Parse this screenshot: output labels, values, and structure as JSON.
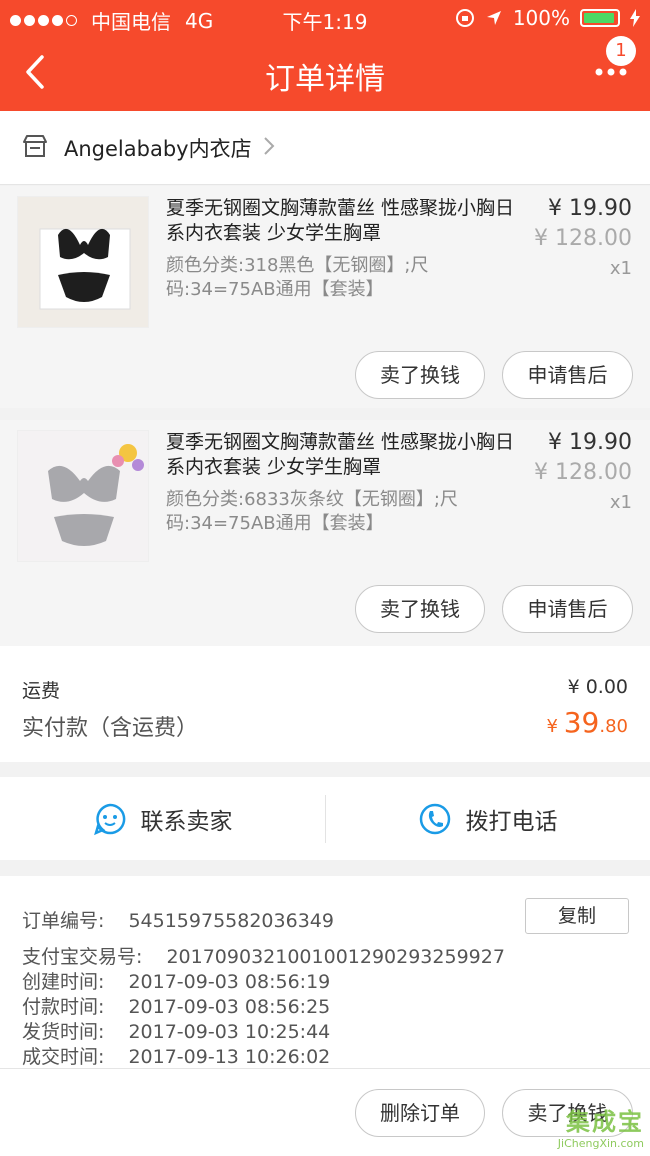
{
  "status_bar": {
    "carrier": "中国电信",
    "network": "4G",
    "time": "下午1:19",
    "battery": "100%"
  },
  "nav": {
    "title": "订单详情",
    "badge": "1"
  },
  "shop": {
    "name": "Angelababy内衣店"
  },
  "products": [
    {
      "title": "夏季无钢圈文胸薄款蕾丝 性感聚拢小胸日系内衣套装 少女学生胸罩",
      "spec": "颜色分类:318黑色【无钢圈】;尺码:34=75AB通用【套装】",
      "price": "¥ 19.90",
      "original_price": "¥ 128.00",
      "qty": "x1",
      "btn_sell": "卖了换钱",
      "btn_after": "申请售后"
    },
    {
      "title": "夏季无钢圈文胸薄款蕾丝 性感聚拢小胸日系内衣套装 少女学生胸罩",
      "spec": "颜色分类:6833灰条纹【无钢圈】;尺码:34=75AB通用【套装】",
      "price": "¥ 19.90",
      "original_price": "¥ 128.00",
      "qty": "x1",
      "btn_sell": "卖了换钱",
      "btn_after": "申请售后"
    }
  ],
  "totals": {
    "shipping_label": "运费",
    "shipping_value": "¥ 0.00",
    "paid_label": "实付款（含运费）",
    "paid_symbol": "¥ ",
    "paid_integer": "39",
    "paid_decimal": ".80"
  },
  "contact": {
    "seller": "联系卖家",
    "phone": "拨打电话"
  },
  "order_info": {
    "order_no_label": "订单编号:",
    "order_no": "54515975582036349",
    "copy": "复制",
    "alipay_label": "支付宝交易号:",
    "alipay_no": "2017090321001001290293259927",
    "created_label": "创建时间:",
    "created": "2017-09-03 08:56:19",
    "paid_label": "付款时间:",
    "paid": "2017-09-03 08:56:25",
    "shipped_label": "发货时间:",
    "shipped": "2017-09-03 10:25:44",
    "done_label": "成交时间:",
    "done": "2017-09-13 10:26:02"
  },
  "bottom_actions": {
    "delete": "删除订单",
    "sell": "卖了换钱"
  },
  "watermark": {
    "main": "集成宝",
    "sub": "JiChengXin.com"
  },
  "colors": {
    "brand": "#f64a2c",
    "price_accent": "#f5641e"
  }
}
